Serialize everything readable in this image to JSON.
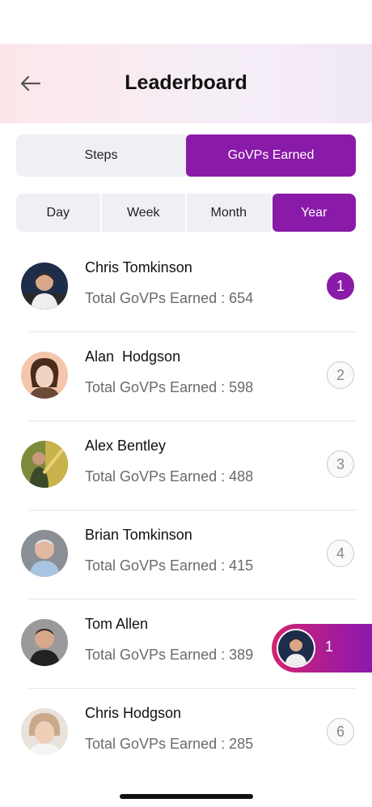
{
  "header": {
    "title": "Leaderboard",
    "back_icon": "arrow-left-icon"
  },
  "metric_tabs": [
    {
      "label": "Steps",
      "active": false
    },
    {
      "label": "GoVPs Earned",
      "active": true
    }
  ],
  "period_tabs": [
    {
      "label": "Day",
      "active": false
    },
    {
      "label": "Week",
      "active": false
    },
    {
      "label": "Month",
      "active": false
    },
    {
      "label": "Year",
      "active": true
    }
  ],
  "leaders": [
    {
      "name": "Chris Tomkinson",
      "points": "Total GoVPs Earned : 654",
      "rank": "1"
    },
    {
      "name": "Alan  Hodgson",
      "points": "Total GoVPs Earned : 598",
      "rank": "2"
    },
    {
      "name": "Alex Bentley",
      "points": "Total GoVPs Earned : 488",
      "rank": "3"
    },
    {
      "name": "Brian Tomkinson",
      "points": "Total GoVPs Earned : 415",
      "rank": "4"
    },
    {
      "name": "Tom Allen",
      "points": "Total GoVPs Earned : 389",
      "rank": "5"
    },
    {
      "name": "Chris Hodgson",
      "points": "Total GoVPs Earned : 285",
      "rank": "6"
    }
  ],
  "my_rank": {
    "rank": "1"
  },
  "colors": {
    "accent": "#8a1aa8",
    "accent_pink": "#d2246e",
    "tab_bg": "#eef0f4"
  }
}
